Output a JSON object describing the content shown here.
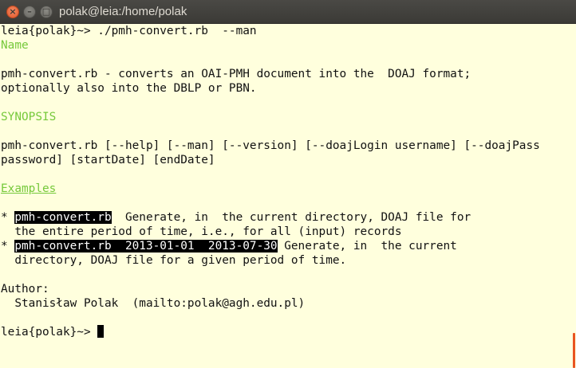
{
  "window": {
    "title": "polak@leia:/home/polak",
    "close_glyph": "×"
  },
  "terminal": {
    "lines": [
      {
        "text": "leia{polak}~> ./pmh-convert.rb  --man"
      },
      {
        "text": "Name"
      },
      {
        "text": ""
      },
      {
        "text": "pmh-convert.rb - converts an OAI-PMH document into the  DOAJ format;"
      },
      {
        "text": "optionally also into the DBLP or PBN."
      },
      {
        "text": ""
      },
      {
        "text": "SYNOPSIS"
      },
      {
        "text": ""
      },
      {
        "text": "pmh-convert.rb [--help] [--man] [--version] [--doajLogin username] [--doajPass"
      },
      {
        "text": "password] [startDate] [endDate]"
      },
      {
        "text": ""
      },
      {
        "text": "Examples"
      },
      {
        "text": ""
      },
      {
        "prefix": "* ",
        "highlight": "pmh-convert.rb",
        "text": "  Generate, in  the current directory, DOAJ file for"
      },
      {
        "text": "  the entire period of time, i.e., for all (input) records"
      },
      {
        "prefix": "* ",
        "highlight": "pmh-convert.rb  2013-01-01  2013-07-30",
        "text": " Generate, in  the current"
      },
      {
        "text": "  directory, DOAJ file for a given period of time."
      },
      {
        "text": ""
      },
      {
        "text": "Author:"
      },
      {
        "text": "  Stanisław Polak  (mailto:polak@agh.edu.pl)"
      },
      {
        "text": ""
      },
      {
        "text": "leia{polak}~> "
      }
    ]
  }
}
